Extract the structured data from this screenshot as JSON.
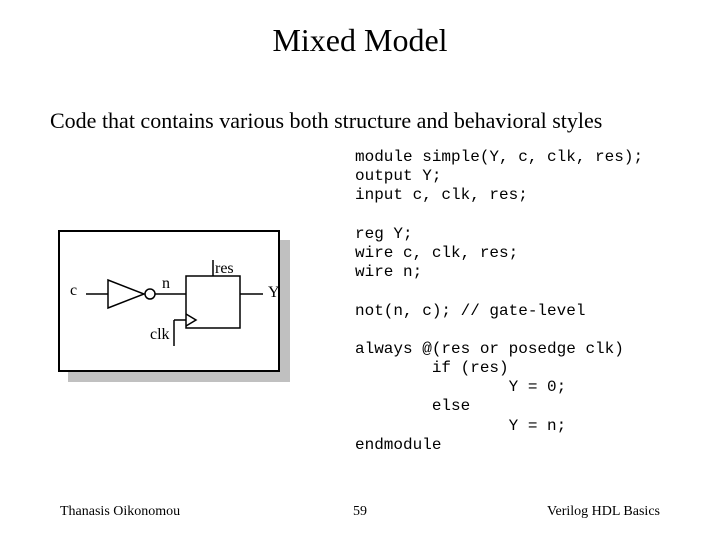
{
  "title": "Mixed Model",
  "subtitle": "Code that contains various both structure and behavioral styles",
  "code": "module simple(Y, c, clk, res);\noutput Y;\ninput c, clk, res;\n\nreg Y;\nwire c, clk, res;\nwire n;\n\nnot(n, c); // gate-level\n\nalways @(res or posedge clk)\n        if (res)\n                Y = 0;\n        else\n                Y = n;\nendmodule",
  "diagram": {
    "labels": {
      "res": "res",
      "c": "c",
      "n": "n",
      "Y": "Y",
      "clk": "clk"
    }
  },
  "footer": {
    "left": "Thanasis Oikonomou",
    "center": "59",
    "right": "Verilog HDL Basics"
  }
}
